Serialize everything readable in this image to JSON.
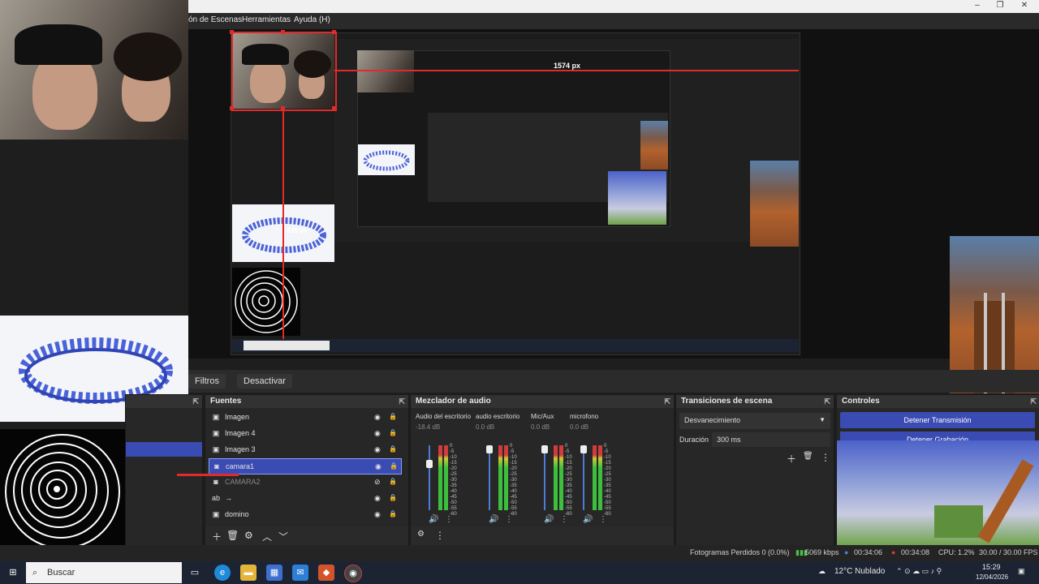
{
  "window": {
    "minimize": "–",
    "maximize": "❐",
    "close": "✕"
  },
  "menu": {
    "scene_collection": "ón de Escenas",
    "tools": "Herramientas",
    "help": "Ayuda (H)"
  },
  "preview": {
    "measure_horizontal": "1574 px",
    "measure_vertical": "819 px"
  },
  "toolbar": {
    "filters": "Filtros",
    "deactivate": "Desactivar"
  },
  "sources": {
    "title": "Fuentes",
    "items": [
      {
        "icon": "image-icon",
        "label": "Imagen",
        "visible": true
      },
      {
        "icon": "image-icon",
        "label": "Imagen 4",
        "visible": true
      },
      {
        "icon": "image-icon",
        "label": "Imagen 3",
        "visible": true
      },
      {
        "icon": "camera-icon",
        "label": "camara1",
        "visible": true,
        "selected": true
      },
      {
        "icon": "camera-icon",
        "label": "CAMARA2",
        "visible": false
      },
      {
        "icon": "text-icon",
        "label": "→",
        "visible": true
      },
      {
        "icon": "image-icon",
        "label": "domino",
        "visible": true
      }
    ]
  },
  "audio_mixer": {
    "title": "Mezclador de audio",
    "scale": [
      "0",
      "-5",
      "-10",
      "-15",
      "-20",
      "-25",
      "-30",
      "-35",
      "-40",
      "-45",
      "-50",
      "-55",
      "-60"
    ],
    "channels": [
      {
        "name": "Audio del escritorio",
        "db": "-18.4 dB",
        "level": 0.75
      },
      {
        "name": "audio escritorio",
        "db": "0.0 dB",
        "level": 1.0
      },
      {
        "name": "Mic/Aux",
        "db": "0.0 dB",
        "level": 1.0
      },
      {
        "name": "microfono",
        "db": "0.0 dB",
        "level": 1.0
      }
    ]
  },
  "transitions": {
    "title": "Transiciones de escena",
    "selected": "Desvanecimiento",
    "duration_label": "Duración",
    "duration_value": "300 ms"
  },
  "controls": {
    "title": "Controles",
    "stop_streaming": "Detener Transmisión",
    "stop_recording": "Detener Grabación"
  },
  "status": {
    "dropped_frames": "Fotogramas Perdidos 0 (0.0%)",
    "bitrate": "5069 kbps",
    "stream_time": "00:34:06",
    "rec_time": "00:34:08",
    "cpu": "CPU: 1.2%",
    "fps": "30.00 / 30.00 FPS"
  },
  "taskbar": {
    "search_placeholder": "Buscar",
    "weather": "12°C  Nublado",
    "time": "15:29",
    "date": "12/04/2026"
  },
  "colors": {
    "accent_blue": "#3a4bb3",
    "selection_red": "#e12a2a",
    "panel_bg": "#272727"
  }
}
